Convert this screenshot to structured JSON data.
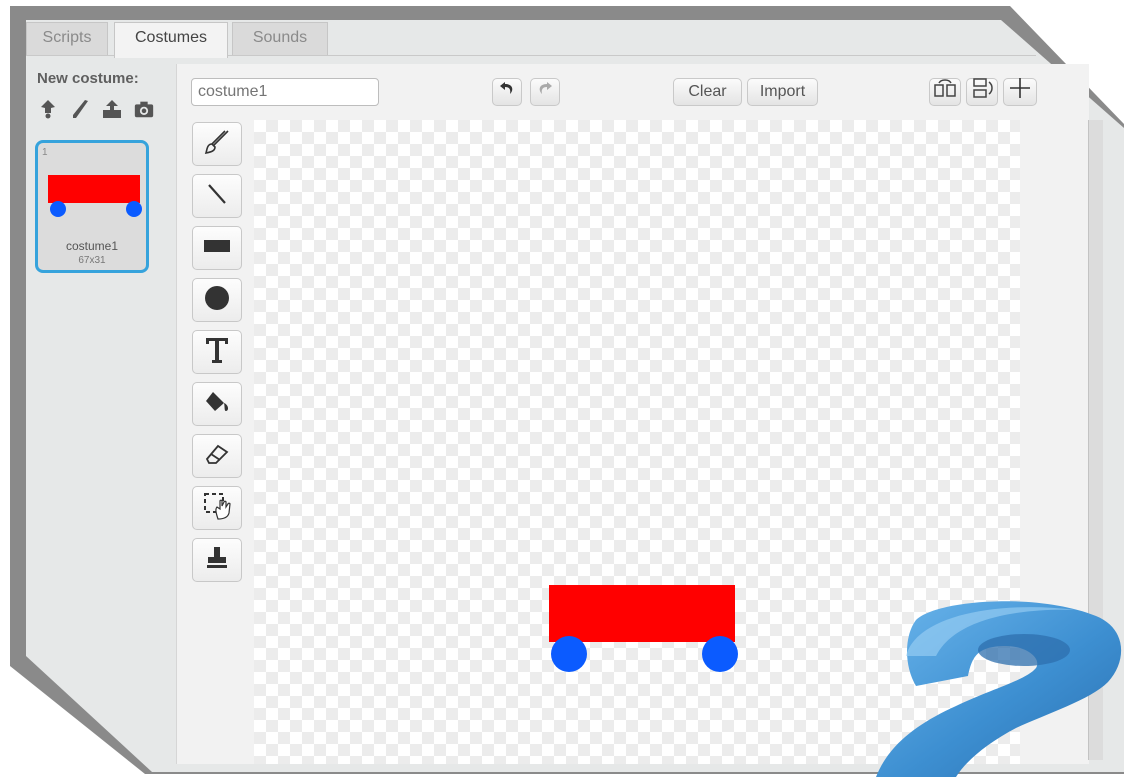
{
  "tabs": [
    {
      "label": "Scripts",
      "active": false
    },
    {
      "label": "Costumes",
      "active": true
    },
    {
      "label": "Sounds",
      "active": false
    }
  ],
  "new_costume": {
    "label": "New costume:",
    "icons": [
      "choose-from-library-icon",
      "paint-new-icon",
      "upload-icon",
      "camera-icon"
    ]
  },
  "costumes": [
    {
      "number": "1",
      "name": "costume1",
      "size": "67x31",
      "selected": true
    }
  ],
  "editor": {
    "costume_name_placeholder": "costume1",
    "undo_icon": "undo-icon",
    "redo_icon": "redo-icon",
    "clear_label": "Clear",
    "import_label": "Import",
    "right_icons": [
      "flip-horizontal-icon",
      "flip-vertical-icon",
      "set-costume-center-icon"
    ]
  },
  "tools": [
    "brush-icon",
    "line-icon",
    "rectangle-icon",
    "ellipse-icon",
    "text-icon",
    "fill-icon",
    "eraser-icon",
    "select-icon",
    "stamp-icon"
  ],
  "colors": {
    "car_body": "#ff0000",
    "wheel": "#0b5bff",
    "selection": "#36a3dc",
    "question_mark": "#3d8fd1"
  }
}
